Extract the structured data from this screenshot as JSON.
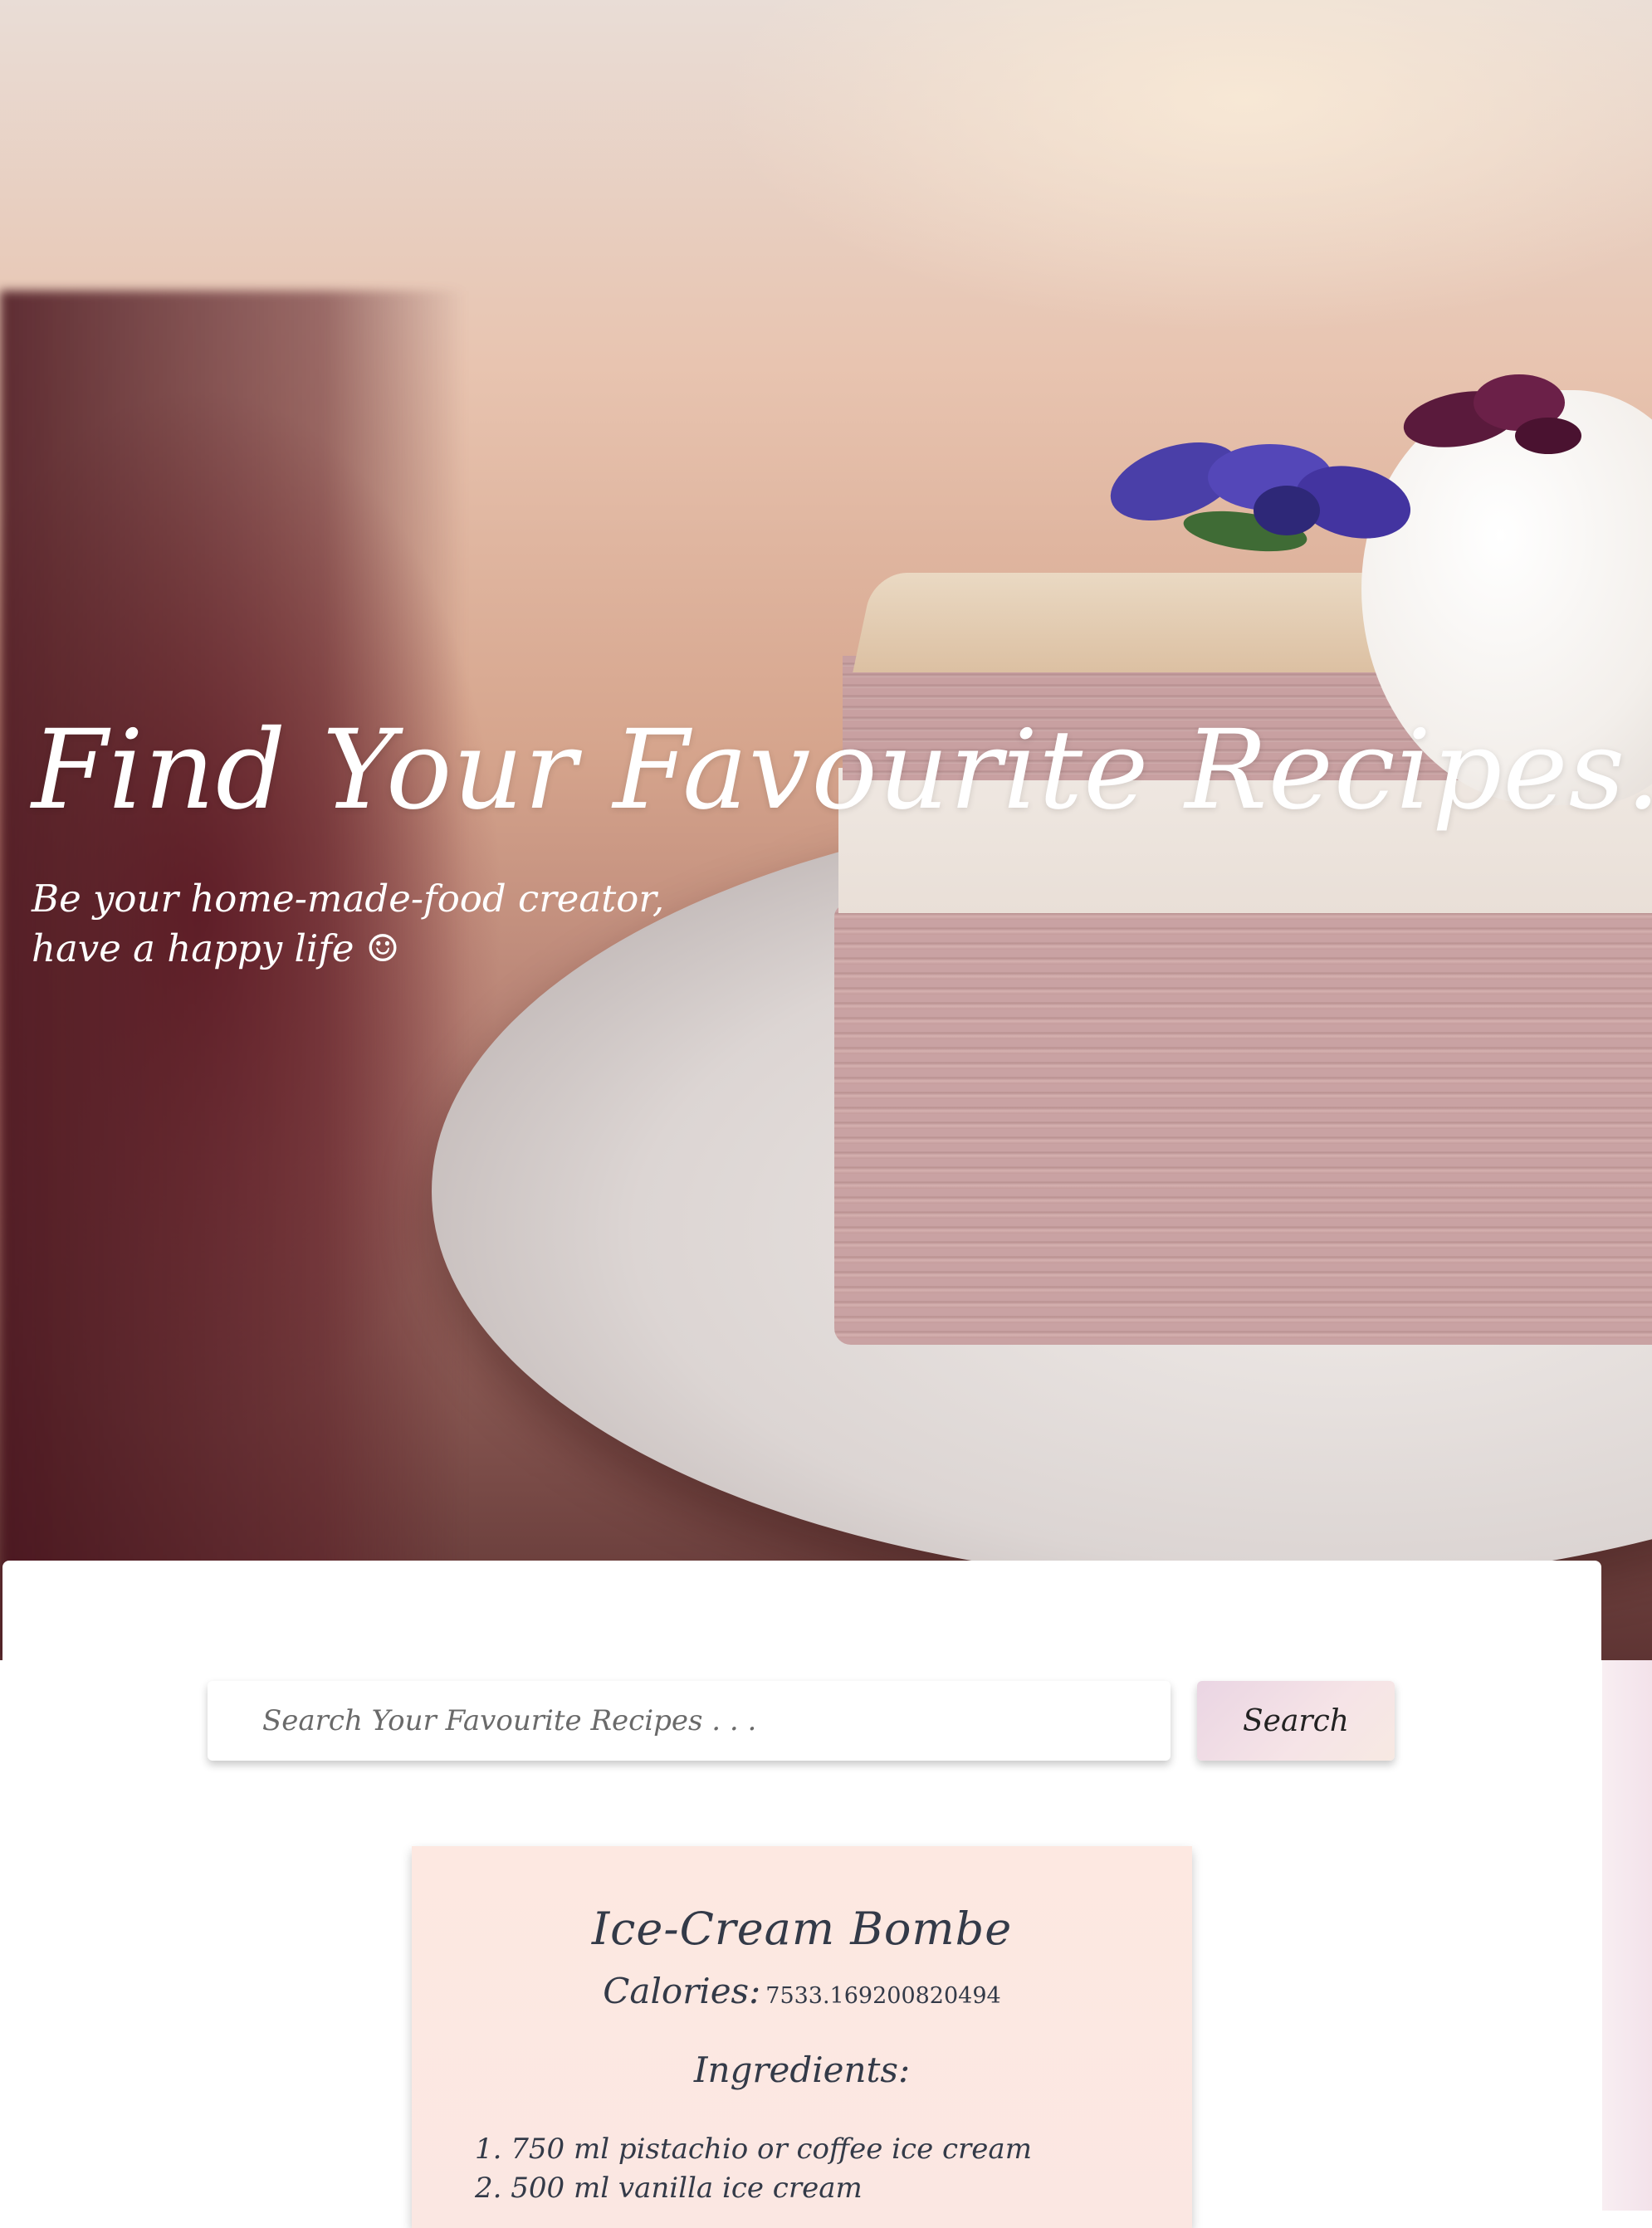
{
  "hero": {
    "title": "Find Your Favourite Recipes.",
    "subtitle_line1": "Be your home-made-food creator,",
    "subtitle_line2": "have a happy life ☺"
  },
  "search": {
    "placeholder": "Search Your Favourite Recipes . . .",
    "value": "",
    "button_label": "Search"
  },
  "recipe": {
    "name": "Ice-Cream Bombe",
    "calories_label": "Calories:",
    "calories_value": "7533.169200820494",
    "ingredients_heading": "Ingredients:",
    "ingredients": [
      "1. 750 ml pistachio or coffee ice cream",
      "2. 500 ml vanilla ice cream"
    ]
  },
  "colors": {
    "recipe_card_bg": "#fde8e1",
    "search_button_bg": "#ead5e3",
    "text_dark": "#333a48"
  },
  "icons": [
    "smiley-emoji"
  ]
}
